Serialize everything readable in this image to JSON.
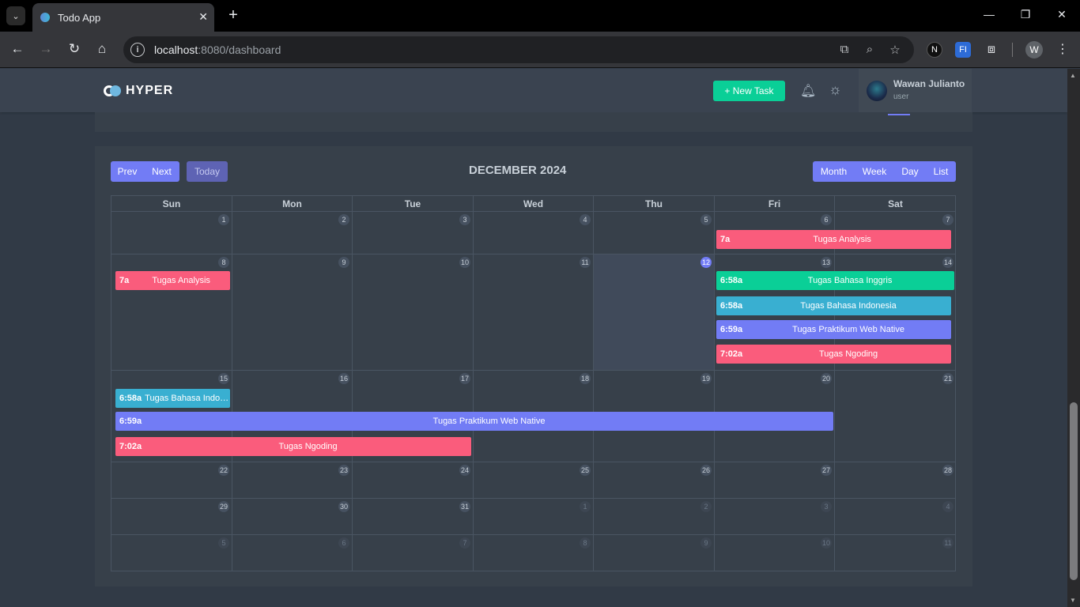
{
  "browser": {
    "tab_title": "Todo App",
    "url_host": "localhost",
    "url_rest": ":8080/dashboard",
    "profile_initial": "W",
    "ext_n": "N",
    "ext_fi": "FI"
  },
  "app": {
    "brand": "HYPER",
    "new_task_label": "+   New Task",
    "user_name": "Wawan Julianto",
    "user_role": "user"
  },
  "calendar": {
    "title": "DECEMBER 2024",
    "buttons": {
      "prev": "Prev",
      "next": "Next",
      "today": "Today",
      "month": "Month",
      "week": "Week",
      "day": "Day",
      "list": "List"
    },
    "weekdays": [
      "Sun",
      "Mon",
      "Tue",
      "Wed",
      "Thu",
      "Fri",
      "Sat"
    ],
    "weeks": [
      [
        "1",
        "2",
        "3",
        "4",
        "5",
        "6",
        "7"
      ],
      [
        "8",
        "9",
        "10",
        "11",
        "12",
        "13",
        "14"
      ],
      [
        "15",
        "16",
        "17",
        "18",
        "19",
        "20",
        "21"
      ],
      [
        "22",
        "23",
        "24",
        "25",
        "26",
        "27",
        "28"
      ],
      [
        "29",
        "30",
        "31",
        "1",
        "2",
        "3",
        "4"
      ],
      [
        "5",
        "6",
        "7",
        "8",
        "9",
        "10",
        "11"
      ]
    ],
    "events": [
      {
        "time": "7a",
        "title": "Tugas Analysis",
        "color": "#fa5c7c"
      },
      {
        "time": "7a",
        "title": "Tugas Analysis",
        "color": "#fa5c7c"
      },
      {
        "time": "6:58a",
        "title": "Tugas Bahasa Inggris",
        "color": "#0acf97"
      },
      {
        "time": "6:58a",
        "title": "Tugas Bahasa Indonesia",
        "color": "#39afd1"
      },
      {
        "time": "6:59a",
        "title": "Tugas Praktikum Web Native",
        "color": "#727cf5"
      },
      {
        "time": "7:02a",
        "title": "Tugas Ngoding",
        "color": "#fa5c7c"
      },
      {
        "time": "6:58a",
        "title": "Tugas Bahasa Indon...",
        "color": "#39afd1"
      },
      {
        "time": "6:59a",
        "title": "Tugas Praktikum Web Native",
        "color": "#727cf5"
      },
      {
        "time": "7:02a",
        "title": "Tugas Ngoding",
        "color": "#fa5c7c"
      }
    ]
  }
}
